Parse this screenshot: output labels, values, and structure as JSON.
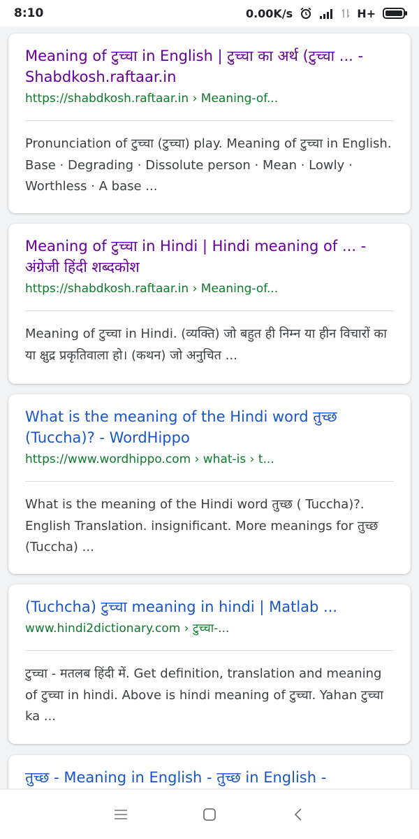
{
  "status_bar": {
    "time": "8:10",
    "network_speed": "0.00K/s",
    "alarm_icon": "alarm-clock-icon",
    "signal_icon": "signal-strength-icon",
    "network_type": "H+",
    "battery_icon": "battery-icon"
  },
  "results": [
    {
      "title": "Meaning of टुच्चा in English | टुच्चा का अर्थ (टुच्चा ... - Shabdkosh.raftaar.in",
      "url": "https://shabdkosh.raftaar.in › Meaning-of...",
      "snippet": "Pronunciation of टुच्चा (टुच्चा) play. Meaning of टुच्चा in English. Base · Degrading · Dissolute person · Mean · Lowly · Worthless · A base ..."
    },
    {
      "title": "Meaning of टुच्चा in Hindi | Hindi meaning of ... - अंग्रेजी हिंदी शब्दकोश",
      "url": "https://shabdkosh.raftaar.in › Meaning-of...",
      "snippet": "Meaning of टुच्चा in Hindi. (व्यक्ति) जो बहुत ही निम्न या हीन विचारों का या क्षुद्र प्रकृतिवाला हो। (कथन) जो अनुचित ..."
    },
    {
      "title": "What is the meaning of the Hindi word तुच्छ (Tuccha)? - WordHippo",
      "url": "https://www.wordhippo.com › what-is › t...",
      "snippet": "What is the meaning of the Hindi word तुच्छ ( Tuccha)?. English Translation. insignificant. More meanings for तुच्छ (Tuccha) ..."
    },
    {
      "title": "(Tuchcha) टुच्चा meaning in hindi | Matlab ...",
      "url": "www.hindi2dictionary.com › टुच्चा-...",
      "snippet": "टुच्चा - मतलब हिंदी में. Get definition, translation and meaning of टुच्चा in hindi. Above is hindi meaning of टुच्चा. Yahan टुच्चा ka ..."
    },
    {
      "title": "तुच्छ - Meaning in English - तुच्छ in English -",
      "url": "",
      "snippet": ""
    }
  ],
  "nav_bar": {
    "menu_icon": "menu-icon",
    "home_icon": "home-square-icon",
    "back_icon": "back-chevron-icon"
  },
  "colors": {
    "visited_link": "#660099",
    "link": "#1a55c8",
    "url_green": "#0d7a2d",
    "snippet_text": "#3c4043",
    "background": "#f1f3f4"
  }
}
